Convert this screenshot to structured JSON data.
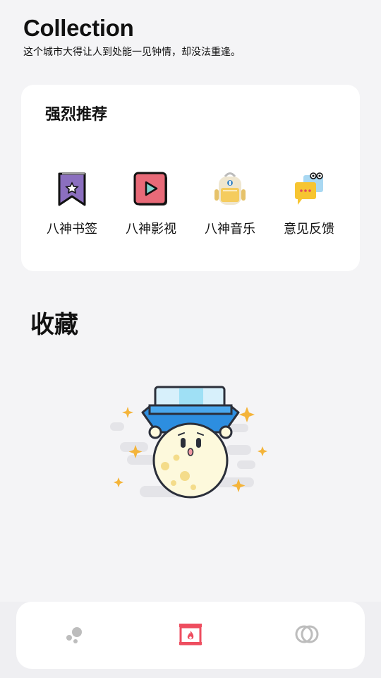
{
  "header": {
    "title": "Collection",
    "subtitle": "这个城市大得让人到处能一见钟情，却没法重逢。"
  },
  "recommend": {
    "title": "强烈推荐",
    "items": [
      {
        "label": "八神书签",
        "icon": "bookmark-icon",
        "color": "#8b6fbf"
      },
      {
        "label": "八神影视",
        "icon": "play-video-icon",
        "color": "#e86a78"
      },
      {
        "label": "八神音乐",
        "icon": "backpack-icon",
        "color": "#f2c75c"
      },
      {
        "label": "意见反馈",
        "icon": "feedback-chat-icon",
        "color": "#f7c531"
      }
    ]
  },
  "collection": {
    "title": "收藏",
    "empty_illustration": "moon-with-box-illustration"
  },
  "tabbar": {
    "tabs": [
      {
        "name": "dots-tab",
        "icon": "dots-icon",
        "active": false
      },
      {
        "name": "fireplace-tab",
        "icon": "fireplace-icon",
        "active": true
      },
      {
        "name": "rings-tab",
        "icon": "rings-icon",
        "active": false
      }
    ],
    "active_color": "#ee4d5f",
    "inactive_color": "#bdbdbd"
  }
}
